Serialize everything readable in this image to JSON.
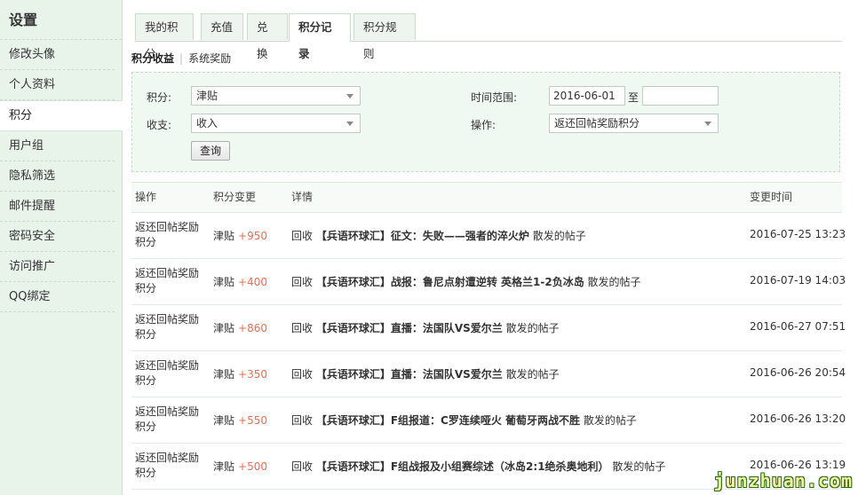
{
  "sidebar": {
    "title": "设置",
    "items": [
      {
        "label": "修改头像"
      },
      {
        "label": "个人资料"
      },
      {
        "label": "积分"
      },
      {
        "label": "用户组"
      },
      {
        "label": "隐私筛选"
      },
      {
        "label": "邮件提醒"
      },
      {
        "label": "密码安全"
      },
      {
        "label": "访问推广"
      },
      {
        "label": "QQ绑定"
      }
    ],
    "active_index": 2
  },
  "tabs": [
    {
      "label": "我的积分"
    },
    {
      "label": "充值"
    },
    {
      "label": "兑换"
    },
    {
      "label": "积分记录"
    },
    {
      "label": "积分规则"
    }
  ],
  "active_tab": 3,
  "subtabs": {
    "income": "积分收益",
    "system": "系统奖励",
    "separator": "|"
  },
  "filter": {
    "credit_label": "积分:",
    "credit_value": "津贴",
    "inout_label": "收支:",
    "inout_value": "收入",
    "time_label": "时间范围:",
    "date_from": "2016-06-01",
    "to_label": "至",
    "date_to": "",
    "action_label": "操作:",
    "action_value": "返还回帖奖励积分",
    "query_button": "查询"
  },
  "table": {
    "headers": {
      "action": "操作",
      "change": "积分变更",
      "detail": "详情",
      "time": "变更时间"
    },
    "rows": [
      {
        "action": "返还回帖奖励积分",
        "credit": "津贴",
        "amount": "+950",
        "prefix": "回收",
        "title": "【兵语环球汇】征文：失败——强者的淬火炉",
        "suffix": "散发的帖子",
        "time": "2016-07-25 13:23"
      },
      {
        "action": "返还回帖奖励积分",
        "credit": "津贴",
        "amount": "+400",
        "prefix": "回收",
        "title": "【兵语环球汇】战报：鲁尼点射遭逆转 英格兰1-2负冰岛",
        "suffix": "散发的帖子",
        "time": "2016-07-19 14:03"
      },
      {
        "action": "返还回帖奖励积分",
        "credit": "津贴",
        "amount": "+860",
        "prefix": "回收",
        "title": "【兵语环球汇】直播：法国队VS爱尔兰",
        "suffix": "散发的帖子",
        "time": "2016-06-27 07:51"
      },
      {
        "action": "返还回帖奖励积分",
        "credit": "津贴",
        "amount": "+350",
        "prefix": "回收",
        "title": "【兵语环球汇】直播：法国队VS爱尔兰",
        "suffix": "散发的帖子",
        "time": "2016-06-26 20:54"
      },
      {
        "action": "返还回帖奖励积分",
        "credit": "津贴",
        "amount": "+550",
        "prefix": "回收",
        "title": "【兵语环球汇】F组报道：C罗连续哑火 葡萄牙两战不胜",
        "suffix": "散发的帖子",
        "time": "2016-06-26 13:20"
      },
      {
        "action": "返还回帖奖励积分",
        "credit": "津贴",
        "amount": "+500",
        "prefix": "回收",
        "title": "【兵语环球汇】F组战报及小组赛综述（冰岛2:1绝杀奥地利）",
        "suffix": "散发的帖子",
        "time": "2016-06-26 13:19"
      }
    ]
  },
  "watermark": "junzhuan.com",
  "colors": {
    "accent_amount": "#f26c4f",
    "sidebar_bg": "#e8f3ea",
    "filter_bg": "#f0f8f2"
  }
}
